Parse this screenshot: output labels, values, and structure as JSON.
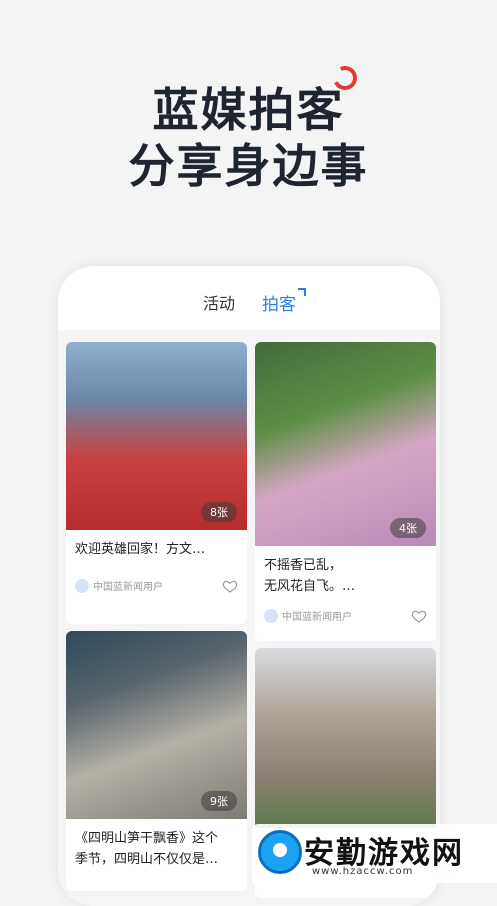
{
  "hero": {
    "line1": "蓝媒拍客",
    "line2": "分享身边事"
  },
  "tabs": [
    {
      "label": "活动"
    },
    {
      "label": "拍客"
    }
  ],
  "cards": [
    {
      "count": "8张",
      "title": "欢迎英雄回家！方文…",
      "author": "中国蓝新闻用户"
    },
    {
      "count": "4张",
      "title1": "不摇香已乱，",
      "title2": "无风花自飞。…",
      "author": "中国蓝新闻用户"
    },
    {
      "count": "9张",
      "title1": "《四明山笋干飘香》这个",
      "title2": "季节，四明山不仅仅是…"
    },
    {}
  ],
  "watermark": {
    "text": "安勤游戏网",
    "url": "www.hzaccw.com"
  },
  "colors": {
    "accent": "#2a7ff0",
    "brand_red": "#e53935"
  }
}
